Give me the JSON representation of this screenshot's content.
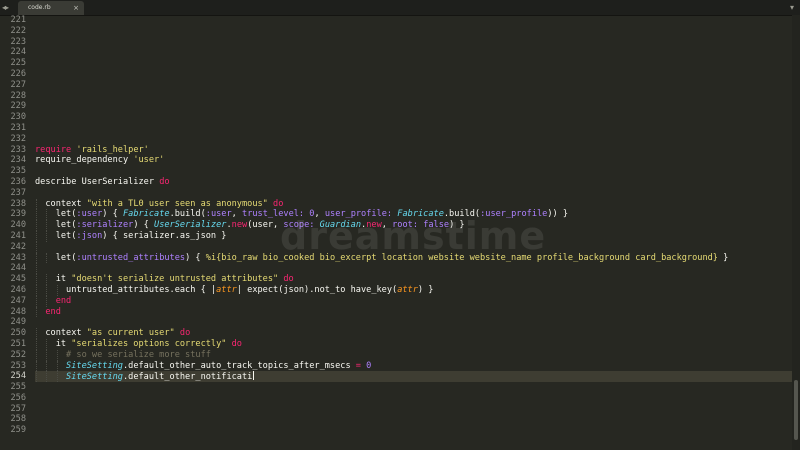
{
  "tab": {
    "title": "code.rb",
    "close_glyph": "×"
  },
  "newtab_glyph": "▾",
  "nav_glyph": "◂▸",
  "editor": {
    "lines": [
      {
        "n": "221",
        "segs": []
      },
      {
        "n": "222",
        "segs": []
      },
      {
        "n": "223",
        "segs": []
      },
      {
        "n": "224",
        "segs": []
      },
      {
        "n": "225",
        "segs": []
      },
      {
        "n": "226",
        "segs": []
      },
      {
        "n": "227",
        "segs": []
      },
      {
        "n": "228",
        "segs": []
      },
      {
        "n": "229",
        "segs": []
      },
      {
        "n": "230",
        "segs": []
      },
      {
        "n": "231",
        "segs": []
      },
      {
        "n": "232",
        "segs": []
      },
      {
        "n": "233",
        "segs": [
          {
            "t": "require",
            "c": "kw"
          },
          {
            "t": " "
          },
          {
            "t": "'rails_helper'",
            "c": "str"
          }
        ]
      },
      {
        "n": "234",
        "segs": [
          {
            "t": "require_dependency "
          },
          {
            "t": "'user'",
            "c": "str"
          }
        ]
      },
      {
        "n": "235",
        "segs": []
      },
      {
        "n": "236",
        "segs": [
          {
            "t": "describe UserSerializer "
          },
          {
            "t": "do",
            "c": "kw"
          }
        ]
      },
      {
        "n": "237",
        "segs": []
      },
      {
        "n": "238",
        "guides": [
          0
        ],
        "segs": [
          {
            "t": "  context "
          },
          {
            "t": "\"with a TL0 user seen as anonymous\"",
            "c": "str"
          },
          {
            "t": " "
          },
          {
            "t": "do",
            "c": "kw"
          }
        ]
      },
      {
        "n": "239",
        "guides": [
          0,
          1
        ],
        "segs": [
          {
            "t": "    let("
          },
          {
            "t": ":user",
            "c": "sym"
          },
          {
            "t": ") { "
          },
          {
            "t": "Fabricate",
            "c": "cls"
          },
          {
            "t": ".build("
          },
          {
            "t": ":user",
            "c": "sym"
          },
          {
            "t": ", "
          },
          {
            "t": "trust_level:",
            "c": "sym"
          },
          {
            "t": " "
          },
          {
            "t": "0",
            "c": "num"
          },
          {
            "t": ", "
          },
          {
            "t": "user_profile:",
            "c": "sym"
          },
          {
            "t": " "
          },
          {
            "t": "Fabricate",
            "c": "cls"
          },
          {
            "t": ".build("
          },
          {
            "t": ":user_profile",
            "c": "sym"
          },
          {
            "t": ")) }"
          }
        ]
      },
      {
        "n": "240",
        "guides": [
          0,
          1
        ],
        "segs": [
          {
            "t": "    let("
          },
          {
            "t": ":serializer",
            "c": "sym"
          },
          {
            "t": ") { "
          },
          {
            "t": "UserSerializer",
            "c": "cls"
          },
          {
            "t": "."
          },
          {
            "t": "new",
            "c": "kw"
          },
          {
            "t": "(user, "
          },
          {
            "t": "scope:",
            "c": "sym"
          },
          {
            "t": " "
          },
          {
            "t": "Guardian",
            "c": "cls"
          },
          {
            "t": "."
          },
          {
            "t": "new",
            "c": "kw"
          },
          {
            "t": ", "
          },
          {
            "t": "root:",
            "c": "sym"
          },
          {
            "t": " "
          },
          {
            "t": "false",
            "c": "num"
          },
          {
            "t": ") }"
          }
        ]
      },
      {
        "n": "241",
        "guides": [
          0,
          1
        ],
        "segs": [
          {
            "t": "    let("
          },
          {
            "t": ":json",
            "c": "sym"
          },
          {
            "t": ") { serializer.as_json }"
          }
        ]
      },
      {
        "n": "242",
        "guides": [
          0
        ],
        "segs": []
      },
      {
        "n": "243",
        "guides": [
          0,
          1
        ],
        "segs": [
          {
            "t": "    let("
          },
          {
            "t": ":untrusted_attributes",
            "c": "sym"
          },
          {
            "t": ") { "
          },
          {
            "t": "%i{bio_raw bio_cooked bio_excerpt location website website_name profile_background card_background}",
            "c": "str"
          },
          {
            "t": " }"
          }
        ]
      },
      {
        "n": "244",
        "guides": [
          0
        ],
        "segs": []
      },
      {
        "n": "245",
        "guides": [
          0,
          1
        ],
        "segs": [
          {
            "t": "    it "
          },
          {
            "t": "\"doesn't serialize untrusted attributes\"",
            "c": "str"
          },
          {
            "t": " "
          },
          {
            "t": "do",
            "c": "kw"
          }
        ]
      },
      {
        "n": "246",
        "guides": [
          0,
          1,
          2
        ],
        "segs": [
          {
            "t": "      untrusted_attributes.each { |"
          },
          {
            "t": "attr",
            "c": "var"
          },
          {
            "t": "| expect(json).not_to have_key("
          },
          {
            "t": "attr",
            "c": "var"
          },
          {
            "t": ") }"
          }
        ]
      },
      {
        "n": "247",
        "guides": [
          0,
          1
        ],
        "segs": [
          {
            "t": "    "
          },
          {
            "t": "end",
            "c": "kw"
          }
        ]
      },
      {
        "n": "248",
        "guides": [
          0
        ],
        "segs": [
          {
            "t": "  "
          },
          {
            "t": "end",
            "c": "kw"
          }
        ]
      },
      {
        "n": "249",
        "segs": []
      },
      {
        "n": "250",
        "guides": [
          0
        ],
        "segs": [
          {
            "t": "  context "
          },
          {
            "t": "\"as current user\"",
            "c": "str"
          },
          {
            "t": " "
          },
          {
            "t": "do",
            "c": "kw"
          }
        ]
      },
      {
        "n": "251",
        "guides": [
          0,
          1
        ],
        "segs": [
          {
            "t": "    it "
          },
          {
            "t": "\"serializes options correctly\"",
            "c": "str"
          },
          {
            "t": " "
          },
          {
            "t": "do",
            "c": "kw"
          }
        ]
      },
      {
        "n": "252",
        "guides": [
          0,
          1,
          2
        ],
        "segs": [
          {
            "t": "      "
          },
          {
            "t": "# so we serialize more stuff",
            "c": "cm"
          }
        ]
      },
      {
        "n": "253",
        "guides": [
          0,
          1,
          2
        ],
        "segs": [
          {
            "t": "      "
          },
          {
            "t": "SiteSetting",
            "c": "cls"
          },
          {
            "t": ".default_other_auto_track_topics_after_msecs "
          },
          {
            "t": "=",
            "c": "kw"
          },
          {
            "t": " "
          },
          {
            "t": "0",
            "c": "num"
          }
        ]
      },
      {
        "n": "254",
        "current": true,
        "cursor": true,
        "guides": [
          0,
          1,
          2
        ],
        "segs": [
          {
            "t": "      "
          },
          {
            "t": "SiteSetting",
            "c": "cls"
          },
          {
            "t": ".default_other_notificati"
          }
        ]
      },
      {
        "n": "255",
        "segs": []
      },
      {
        "n": "256",
        "segs": []
      },
      {
        "n": "257",
        "segs": []
      },
      {
        "n": "258",
        "segs": []
      },
      {
        "n": "259",
        "segs": []
      }
    ]
  },
  "watermark": {
    "text": "dreamstime"
  },
  "colors": {
    "background": "#272822",
    "keyword": "#f92672",
    "string": "#e6db74",
    "symbol": "#ae81ff",
    "class": "#66d9ef",
    "variable": "#fd971f",
    "comment": "#75715e"
  }
}
